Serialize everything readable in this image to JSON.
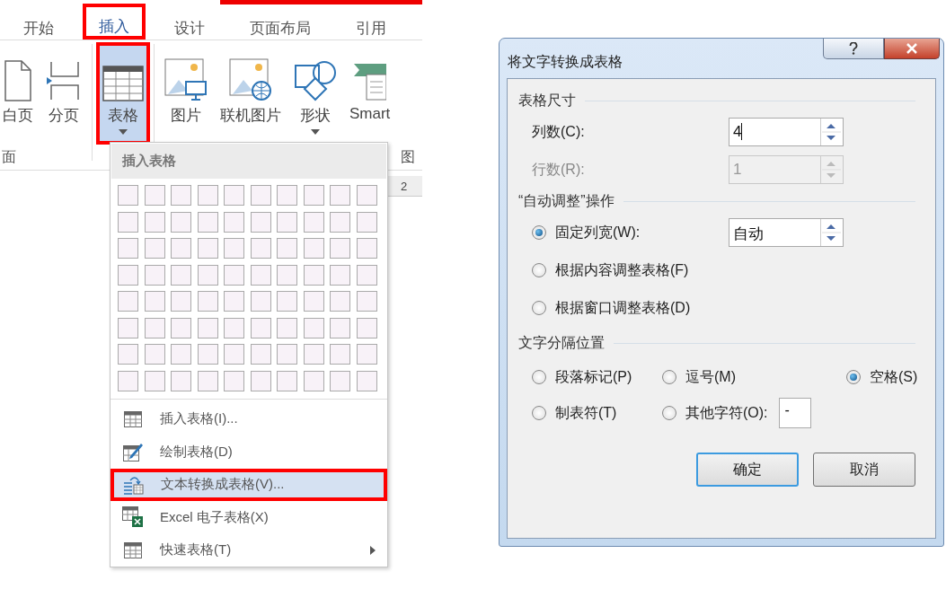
{
  "ribbon": {
    "tabs": [
      {
        "label": "开始",
        "selected": false,
        "highlighted": false
      },
      {
        "label": "插入",
        "selected": true,
        "highlighted": true
      },
      {
        "label": "设计",
        "selected": false,
        "highlighted": false
      },
      {
        "label": "页面布局",
        "selected": false,
        "highlighted": false
      },
      {
        "label": "引用",
        "selected": false,
        "highlighted": false
      }
    ],
    "buttons": [
      {
        "label": "白页",
        "kind": "page",
        "pressed": false,
        "highlighted": false,
        "dropdown": false
      },
      {
        "label": "分页",
        "kind": "break",
        "pressed": false,
        "highlighted": false,
        "dropdown": false
      },
      {
        "label": "表格",
        "kind": "table",
        "pressed": true,
        "highlighted": true,
        "dropdown": true
      },
      {
        "label": "图片",
        "kind": "picture",
        "pressed": false,
        "highlighted": false,
        "dropdown": false
      },
      {
        "label": "联机图片",
        "kind": "online",
        "pressed": false,
        "highlighted": false,
        "dropdown": false
      },
      {
        "label": "形状",
        "kind": "shapes",
        "pressed": false,
        "highlighted": false,
        "dropdown": true
      },
      {
        "label": "Smart",
        "kind": "smartart",
        "pressed": false,
        "highlighted": false,
        "dropdown": false
      }
    ],
    "groups": [
      "面",
      "图"
    ]
  },
  "ruler": {
    "label": "2"
  },
  "table_menu": {
    "title": "插入表格",
    "items": [
      {
        "label": "插入表格(I)...",
        "kind": "grid",
        "selected": false,
        "highlighted": false,
        "submenu": false
      },
      {
        "label": "绘制表格(D)",
        "kind": "draw",
        "selected": false,
        "highlighted": false,
        "submenu": false
      },
      {
        "label": "文本转换成表格(V)...",
        "kind": "convert",
        "selected": true,
        "highlighted": true,
        "submenu": false
      },
      {
        "label": "Excel 电子表格(X)",
        "kind": "excel",
        "selected": false,
        "highlighted": false,
        "submenu": false
      },
      {
        "label": "快速表格(T)",
        "kind": "grid",
        "selected": false,
        "highlighted": false,
        "submenu": true
      }
    ]
  },
  "dialog": {
    "title": "将文字转换成表格",
    "size_section": {
      "title": "表格尺寸",
      "fields": [
        {
          "label": "列数(C):",
          "value": "4",
          "disabled": false
        },
        {
          "label": "行数(R):",
          "value": "1",
          "disabled": true
        }
      ]
    },
    "autofit_section": {
      "title": "“自动调整”操作",
      "options": [
        {
          "label": "固定列宽(W):",
          "selected": true,
          "value": "自动"
        },
        {
          "label": "根据内容调整表格(F)",
          "selected": false
        },
        {
          "label": "根据窗口调整表格(D)",
          "selected": false
        }
      ]
    },
    "separator_section": {
      "title": "文字分隔位置",
      "options": [
        {
          "label": "段落标记(P)",
          "selected": false
        },
        {
          "label": "逗号(M)",
          "selected": false
        },
        {
          "label": "空格(S)",
          "selected": true
        },
        {
          "label": "制表符(T)",
          "selected": false
        },
        {
          "label": "其他字符(O):",
          "selected": false,
          "value": "-"
        }
      ]
    },
    "buttons": [
      {
        "label": "确定",
        "default": true
      },
      {
        "label": "取消",
        "default": false
      }
    ]
  }
}
